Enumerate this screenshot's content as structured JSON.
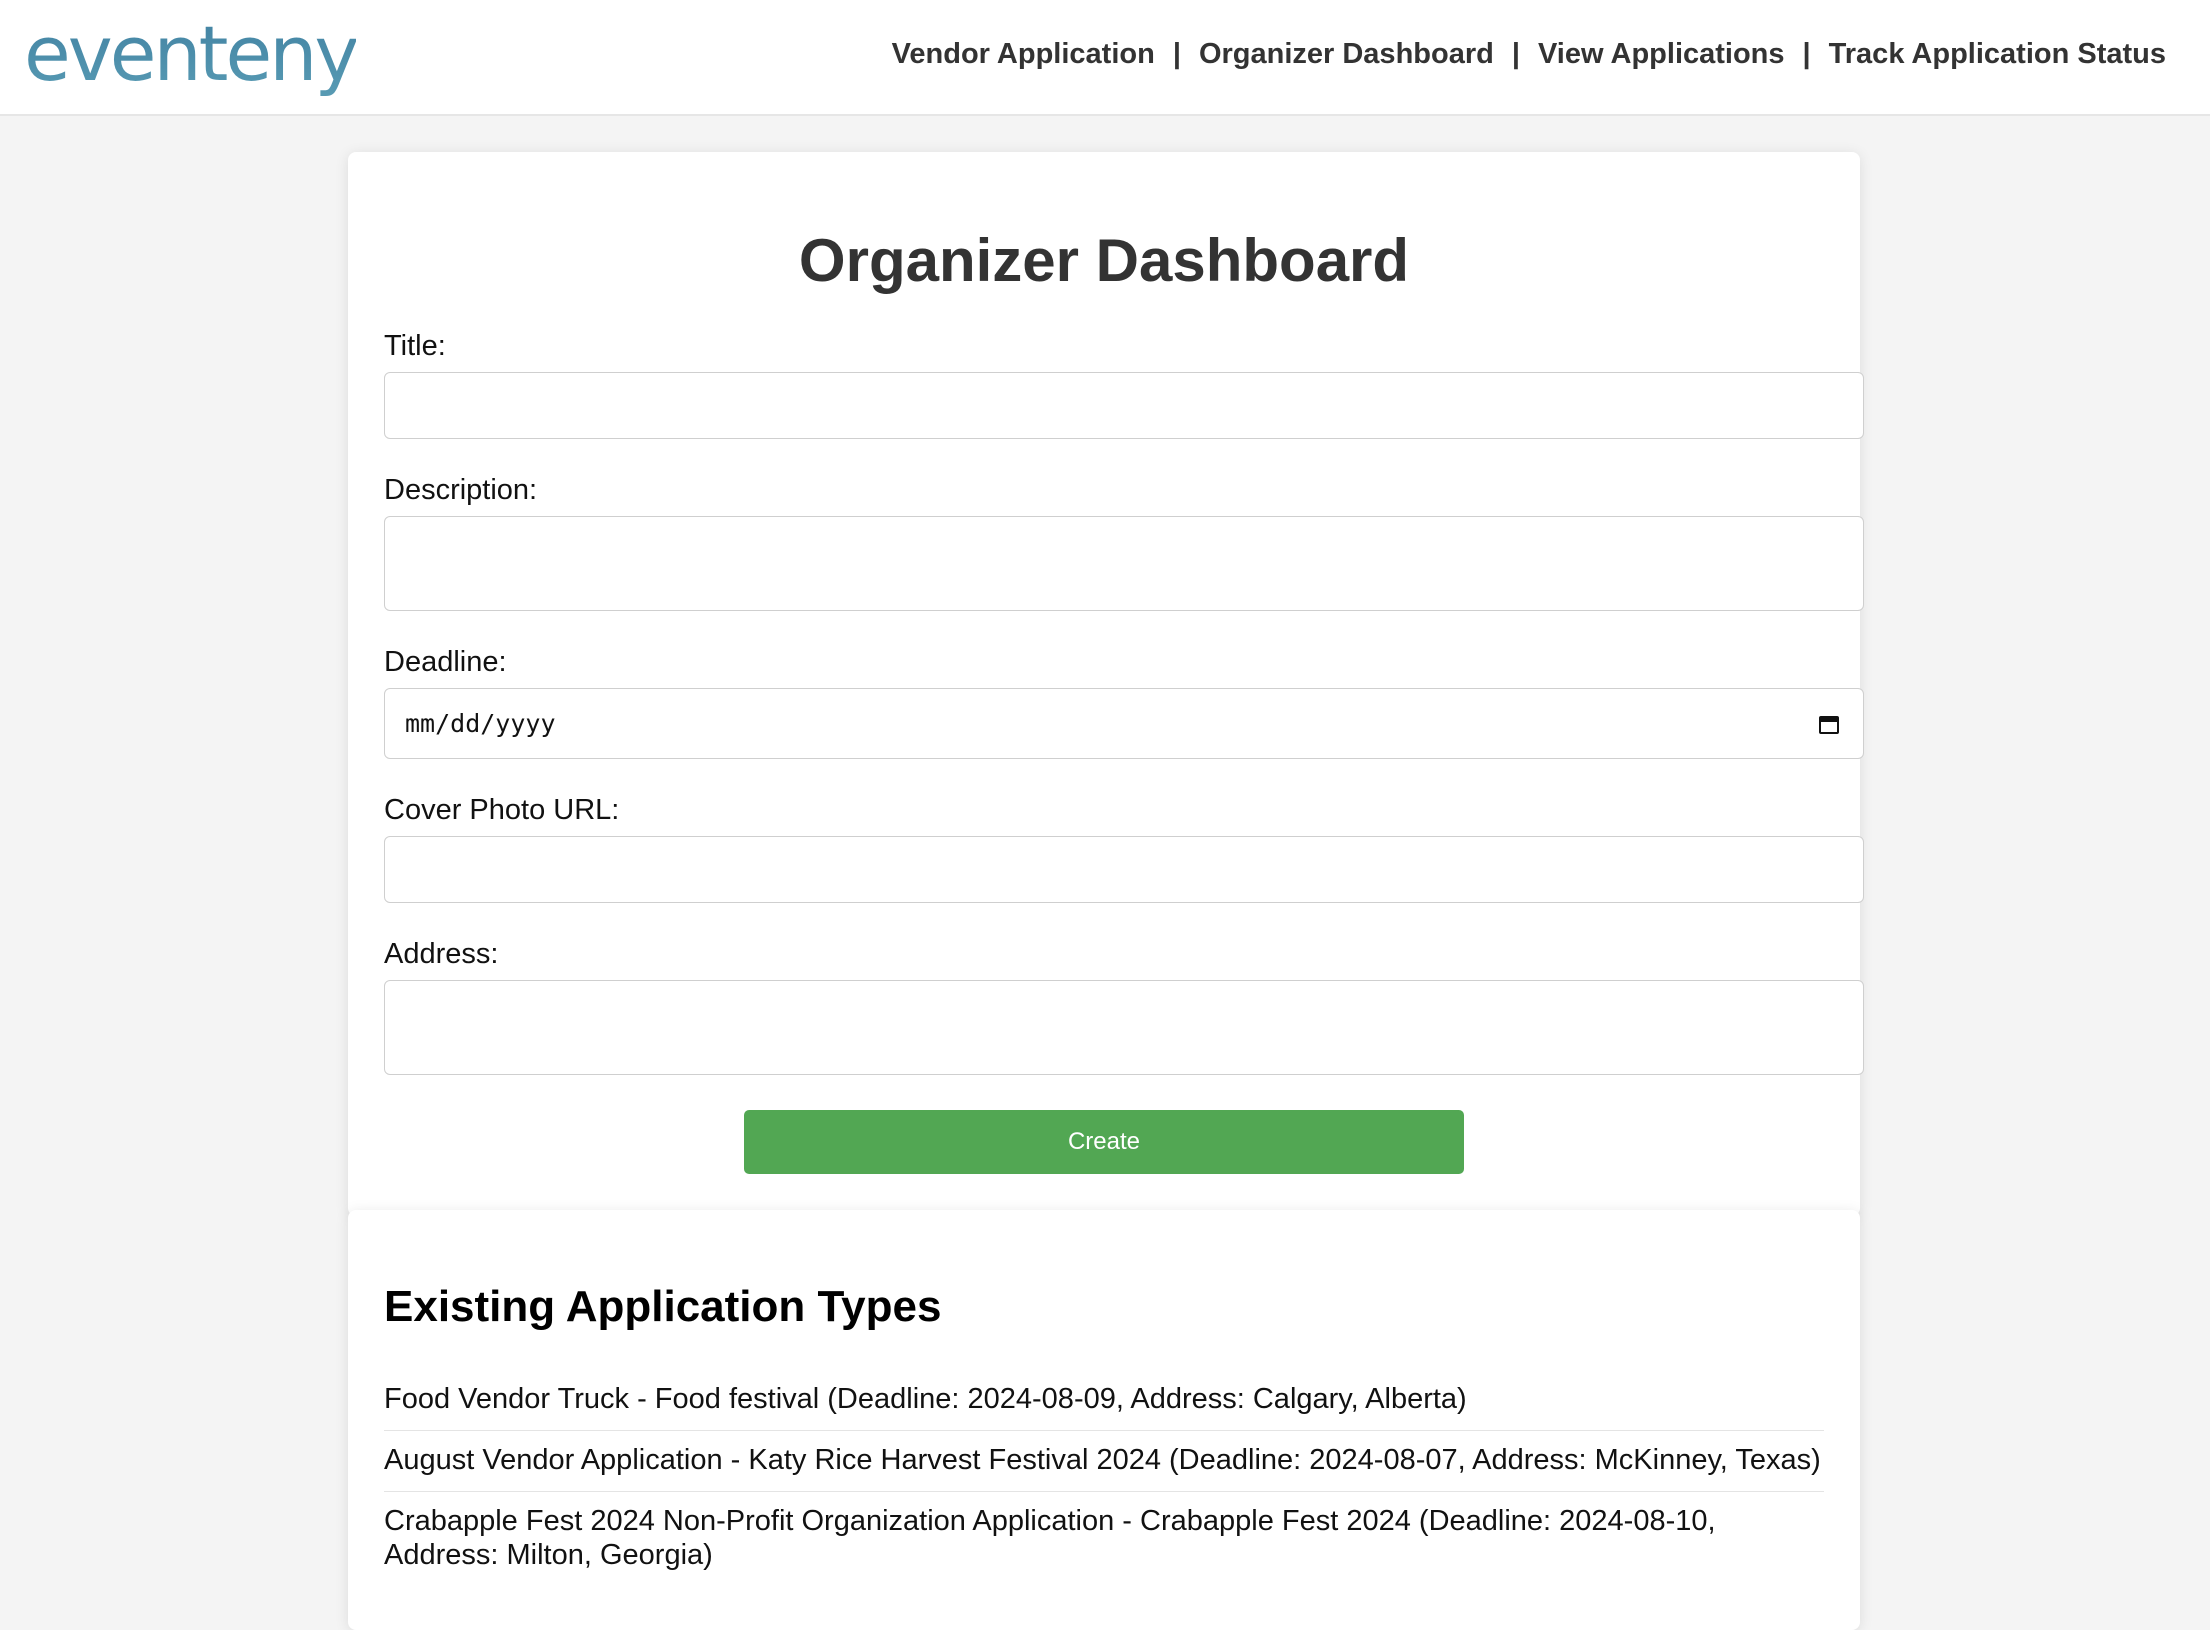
{
  "header": {
    "logo_text": "eventeny",
    "nav": [
      {
        "label": "Vendor Application"
      },
      {
        "label": "Organizer Dashboard"
      },
      {
        "label": "View Applications"
      },
      {
        "label": "Track Application Status"
      }
    ],
    "separator": "|"
  },
  "form": {
    "title": "Organizer Dashboard",
    "fields": {
      "title": {
        "label": "Title:",
        "value": ""
      },
      "description": {
        "label": "Description:",
        "value": ""
      },
      "deadline": {
        "label": "Deadline:",
        "placeholder": "mm/dd/yyyy",
        "icon": "calendar-icon"
      },
      "cover_photo": {
        "label": "Cover Photo URL:",
        "value": ""
      },
      "address": {
        "label": "Address:",
        "value": ""
      }
    },
    "submit_label": "Create",
    "submit_color": "#52a753"
  },
  "existing": {
    "title": "Existing Application Types",
    "items": [
      "Food Vendor Truck - Food festival (Deadline: 2024-08-09, Address: Calgary, Alberta)",
      "August Vendor Application - Katy Rice Harvest Festival 2024 (Deadline: 2024-08-07, Address: McKinney, Texas)",
      "Crabapple Fest 2024 Non-Profit Organization Application - Crabapple Fest 2024 (Deadline: 2024-08-10, Address: Milton, Georgia)"
    ]
  }
}
